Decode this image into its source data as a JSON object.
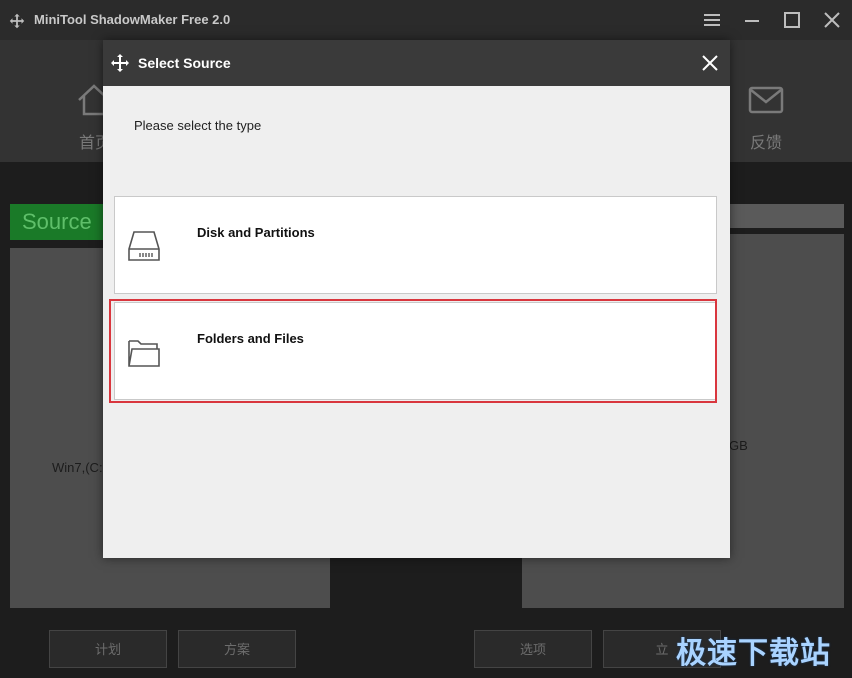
{
  "app": {
    "title": "MiniTool ShadowMaker Free 2.0"
  },
  "nav": {
    "home_label": "首页",
    "feedback_label": "反馈"
  },
  "background": {
    "source_tab": "Source",
    "left_panel_text": "Win7,(C:",
    "right_panel_text": "GB",
    "buttons": [
      "计划",
      "方案",
      "选项",
      "立"
    ]
  },
  "dialog": {
    "title": "Select Source",
    "prompt": "Please select the type",
    "options": [
      {
        "label": "Disk and Partitions",
        "icon": "disk-drive-icon"
      },
      {
        "label": "Folders and Files",
        "icon": "folder-icon",
        "selected": true
      }
    ]
  },
  "watermark": "极速下载站",
  "colors": {
    "accent_selection": "#d9363e",
    "source_tab": "#1a7a28",
    "dialog_header": "#3a3a3a"
  }
}
